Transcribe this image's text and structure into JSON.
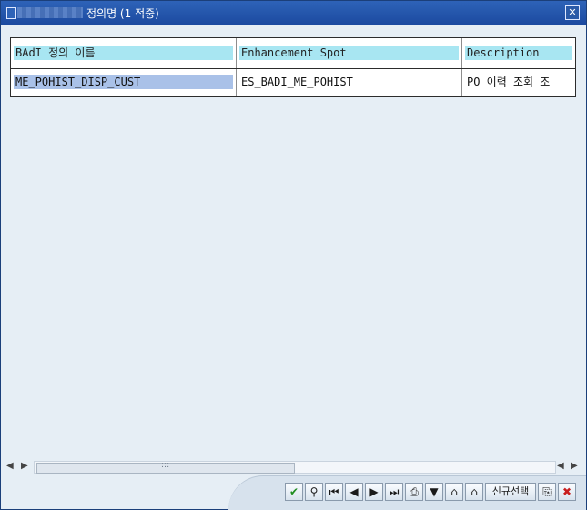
{
  "window": {
    "title_suffix": "정의명 (1 적중)",
    "close_icon": "close-icon"
  },
  "grid": {
    "columns": [
      {
        "label": "BAdI 정의 이름"
      },
      {
        "label": "Enhancement Spot"
      },
      {
        "label": "Description"
      }
    ],
    "rows": [
      {
        "badi_name": "ME_POHIST_DISP_CUST",
        "enhancement_spot": "ES_BADI_ME_POHIST",
        "description": "PO 이력 조회 조"
      }
    ]
  },
  "scrollbar": {
    "left_arrow": "◀",
    "right_arrow": "▶",
    "thumb_grip": ":::"
  },
  "toolbar": {
    "buttons": [
      {
        "name": "check-icon",
        "glyph": "✔"
      },
      {
        "name": "find-icon",
        "glyph": "⚲"
      },
      {
        "name": "first-page-icon",
        "glyph": "⏮"
      },
      {
        "name": "previous-icon",
        "glyph": "◀"
      },
      {
        "name": "next-icon",
        "glyph": "▶"
      },
      {
        "name": "last-page-icon",
        "glyph": "⏭"
      },
      {
        "name": "print-icon",
        "glyph": "⎙"
      },
      {
        "name": "filter-icon",
        "glyph": "▼"
      },
      {
        "name": "binoculars-icon",
        "glyph": "⌂"
      },
      {
        "name": "binoculars-next-icon",
        "glyph": "⌂"
      },
      {
        "name": "new-selection-button",
        "glyph": "신규선택"
      },
      {
        "name": "copy-icon",
        "glyph": "⎘"
      },
      {
        "name": "cancel-icon",
        "glyph": "✖"
      }
    ]
  }
}
